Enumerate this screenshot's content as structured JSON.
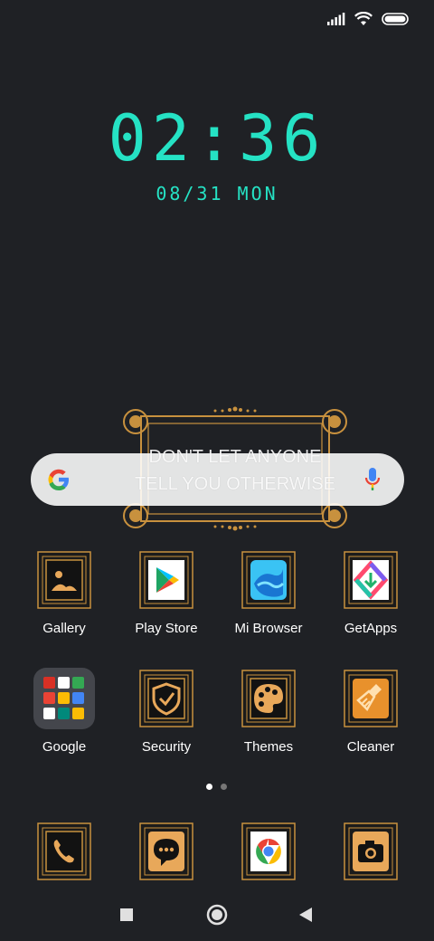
{
  "status_bar": {
    "signal": "signal-bars-icon",
    "wifi": "wifi-icon",
    "battery": "battery-icon"
  },
  "clock": {
    "time": "02:36",
    "date": "08/31 MON"
  },
  "widget": {
    "quote_line1": "DON'T LET ANYONE",
    "quote_line2": "TELL YOU OTHERWISE"
  },
  "search_bar": {
    "logo": "google-g-icon",
    "mic": "microphone-icon"
  },
  "apps_row1": [
    {
      "label": "Gallery",
      "icon": "gallery-icon"
    },
    {
      "label": "Play Store",
      "icon": "play-store-icon"
    },
    {
      "label": "Mi Browser",
      "icon": "browser-icon"
    },
    {
      "label": "GetApps",
      "icon": "getapps-icon"
    }
  ],
  "apps_row2": [
    {
      "label": "Google",
      "icon": "google-folder-icon"
    },
    {
      "label": "Security",
      "icon": "security-icon"
    },
    {
      "label": "Themes",
      "icon": "palette-icon"
    },
    {
      "label": "Cleaner",
      "icon": "broom-icon"
    }
  ],
  "dock": [
    {
      "icon": "phone-icon"
    },
    {
      "icon": "messages-icon"
    },
    {
      "icon": "chrome-icon"
    },
    {
      "icon": "camera-icon"
    }
  ],
  "page_indicator": {
    "count": 2,
    "active": 1
  },
  "nav_bar": {
    "recents": "recents-icon",
    "home": "home-icon",
    "back": "back-icon"
  },
  "colors": {
    "accent": "#25e2c4",
    "gold": "#c8913e",
    "background": "#1f2125"
  }
}
